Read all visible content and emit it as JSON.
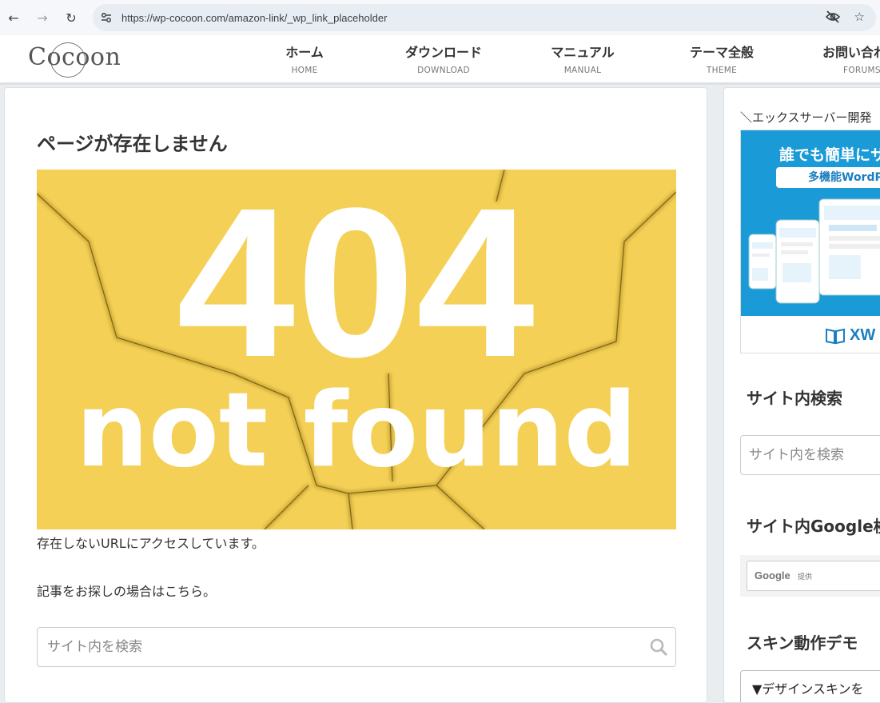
{
  "browser": {
    "url": "https://wp-cocoon.com/amazon-link/_wp_link_placeholder"
  },
  "header": {
    "logo": "Cocoon",
    "menu": [
      {
        "label": "ホーム",
        "sub": "HOME"
      },
      {
        "label": "ダウンロード",
        "sub": "DOWNLOAD"
      },
      {
        "label": "マニュアル",
        "sub": "MANUAL"
      },
      {
        "label": "テーマ全般",
        "sub": "THEME"
      },
      {
        "label": "お問い合わ",
        "sub": "FORUMS"
      }
    ]
  },
  "main": {
    "title": "ページが存在しません",
    "hero_number": "404",
    "hero_text": "not found",
    "message1": "存在しないURLにアクセスしています。",
    "message2": "記事をお探しの場合はこちら。",
    "search_placeholder": "サイト内を検索"
  },
  "sidebar": {
    "promo": "＼エックスサーバー開発",
    "banner": {
      "headline": "誰でも簡単にサ",
      "pill": "多機能WordP",
      "brand": "XW"
    },
    "site_search_heading": "サイト内検索",
    "site_search_placeholder": "サイト内を検索",
    "google_heading": "サイト内Google検",
    "google_logo": "Google",
    "google_by": "提供",
    "skin_heading": "スキン動作デモ",
    "skin_select": "▼デザインスキンを"
  },
  "colors": {
    "hero_bg": "#f5d056",
    "banner_blue": "#1a9ad6",
    "accent_blue": "#1a7fc0"
  }
}
